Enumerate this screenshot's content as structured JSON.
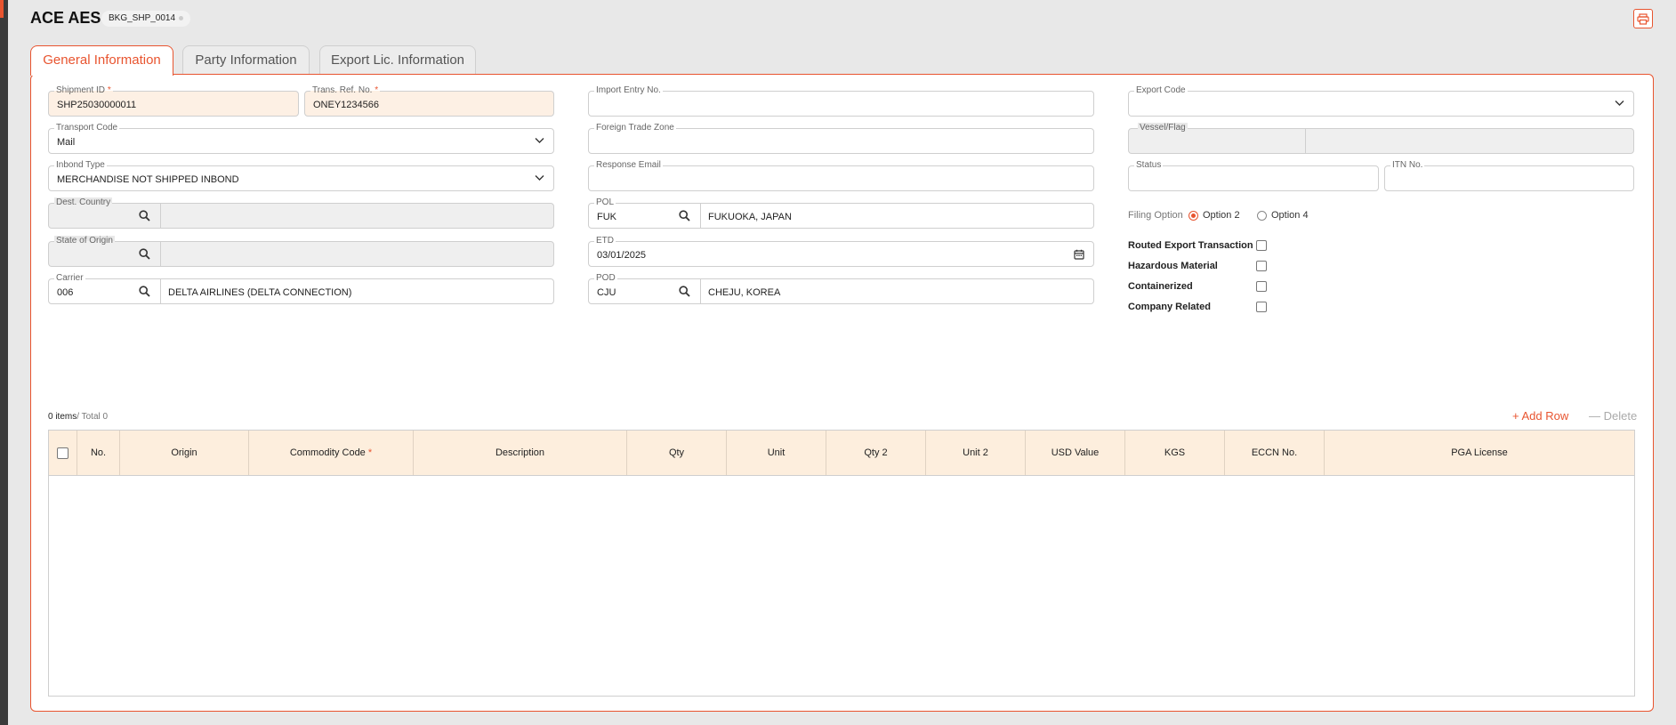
{
  "header": {
    "title": "ACE AES",
    "booking_badge": "BKG_SHP_0014"
  },
  "tabs": [
    {
      "label": "General Information",
      "active": true
    },
    {
      "label": "Party Information",
      "active": false
    },
    {
      "label": "Export Lic. Information",
      "active": false
    }
  ],
  "form": {
    "shipment_id": {
      "label": "Shipment ID",
      "value": "SHP25030000011",
      "required_mark": "*"
    },
    "trans_ref_no": {
      "label": "Trans. Ref. No.",
      "value": "ONEY1234566",
      "required_mark": "*"
    },
    "transport_code": {
      "label": "Transport Code",
      "value": "Mail"
    },
    "inbond_type": {
      "label": "Inbond Type",
      "value": "MERCHANDISE NOT SHIPPED INBOND"
    },
    "dest_country": {
      "label": "Dest. Country",
      "code": "",
      "name": ""
    },
    "state_of_origin": {
      "label": "State of Origin",
      "code": "",
      "name": ""
    },
    "carrier": {
      "label": "Carrier",
      "code": "006",
      "name": "DELTA AIRLINES (DELTA CONNECTION)"
    },
    "import_entry_no": {
      "label": "Import Entry No.",
      "value": ""
    },
    "foreign_trade_zone": {
      "label": "Foreign Trade Zone",
      "value": ""
    },
    "response_email": {
      "label": "Response Email",
      "value": ""
    },
    "pol": {
      "label": "POL",
      "code": "FUK",
      "name": "FUKUOKA, JAPAN"
    },
    "etd": {
      "label": "ETD",
      "value": "03/01/2025"
    },
    "pod": {
      "label": "POD",
      "code": "CJU",
      "name": "CHEJU, KOREA"
    },
    "export_code": {
      "label": "Export Code",
      "value": ""
    },
    "vessel_flag": {
      "label": "Vessel/Flag",
      "vessel": "",
      "flag": ""
    },
    "status": {
      "label": "Status",
      "value": ""
    },
    "itn_no": {
      "label": "ITN No.",
      "value": ""
    },
    "filing_option": {
      "label": "Filing Option",
      "options": [
        "Option 2",
        "Option 4"
      ],
      "selected": "Option 2"
    },
    "checkboxes": [
      {
        "label": "Routed Export Transaction",
        "checked": false
      },
      {
        "label": "Hazardous Material",
        "checked": false
      },
      {
        "label": "Containerized",
        "checked": false
      },
      {
        "label": "Company Related",
        "checked": false
      }
    ]
  },
  "items": {
    "count_label": "0 items",
    "total_label": "/  Total 0",
    "add_row": "Add Row",
    "delete": "Delete",
    "columns": [
      "No.",
      "Origin",
      "Commodity Code",
      "Description",
      "Qty",
      "Unit",
      "Qty 2",
      "Unit 2",
      "USD Value",
      "KGS",
      "ECCN No.",
      "PGA License"
    ],
    "commodity_required_mark": "*",
    "rows": []
  },
  "colors": {
    "accent": "#e8542f",
    "required_bg": "#fdf0e4",
    "header_bg": "#fdeedd"
  }
}
